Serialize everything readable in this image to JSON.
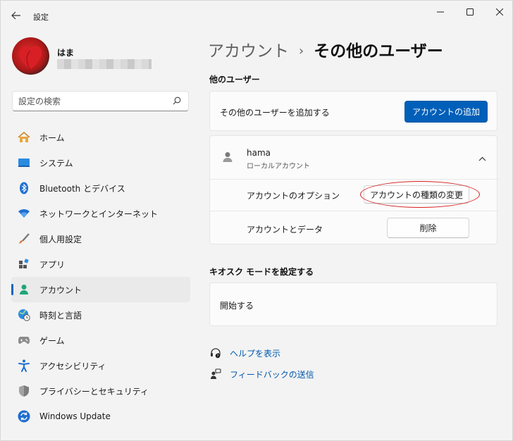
{
  "window": {
    "title": "設定"
  },
  "user": {
    "name": "はま"
  },
  "search": {
    "placeholder": "設定の検索"
  },
  "sidebar": {
    "items": [
      {
        "label": "ホーム",
        "icon": "home-icon"
      },
      {
        "label": "システム",
        "icon": "system-icon"
      },
      {
        "label": "Bluetooth とデバイス",
        "icon": "bluetooth-icon"
      },
      {
        "label": "ネットワークとインターネット",
        "icon": "wifi-icon"
      },
      {
        "label": "個人用設定",
        "icon": "brush-icon"
      },
      {
        "label": "アプリ",
        "icon": "apps-icon"
      },
      {
        "label": "アカウント",
        "icon": "account-icon",
        "active": true
      },
      {
        "label": "時刻と言語",
        "icon": "globe-clock-icon"
      },
      {
        "label": "ゲーム",
        "icon": "gamepad-icon"
      },
      {
        "label": "アクセシビリティ",
        "icon": "accessibility-icon"
      },
      {
        "label": "プライバシーとセキュリティ",
        "icon": "shield-icon"
      },
      {
        "label": "Windows Update",
        "icon": "windows-update-icon"
      }
    ]
  },
  "breadcrumb": {
    "parent": "アカウント",
    "separator": "›",
    "current": "その他のユーザー"
  },
  "other_users": {
    "section_title": "他のユーザー",
    "add_label": "その他のユーザーを追加する",
    "add_button": "アカウントの追加",
    "account": {
      "name": "hama",
      "type": "ローカルアカウント",
      "options_label": "アカウントのオプション",
      "change_type_button": "アカウントの種類の変更",
      "data_label": "アカウントとデータ",
      "delete_button": "削除"
    }
  },
  "kiosk": {
    "section_title": "キオスク モードを設定する",
    "start_label": "開始する"
  },
  "links": {
    "help": "ヘルプを表示",
    "feedback": "フィードバックの送信"
  },
  "colors": {
    "accent": "#005fb8",
    "highlight_ellipse": "#d81e1e"
  }
}
